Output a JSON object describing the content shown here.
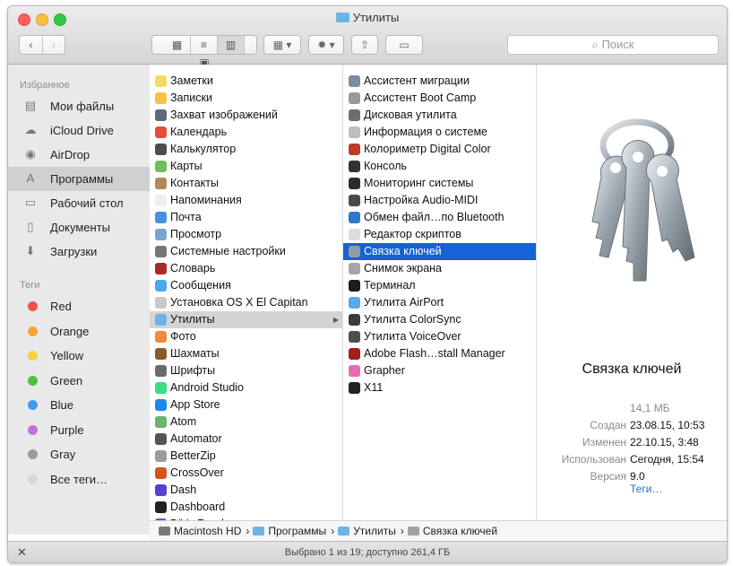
{
  "window": {
    "title": "Утилиты"
  },
  "toolbar": {
    "back": "‹",
    "forward": "›",
    "search_placeholder": "Поиск"
  },
  "sidebar": {
    "favorites_header": "Избранное",
    "favorites": [
      {
        "label": "Мои файлы",
        "icon": "all-files-icon",
        "glyph": "▤"
      },
      {
        "label": "iCloud Drive",
        "icon": "cloud-icon",
        "glyph": "☁"
      },
      {
        "label": "AirDrop",
        "icon": "airdrop-icon",
        "glyph": "◉"
      },
      {
        "label": "Программы",
        "icon": "applications-icon",
        "glyph": "A"
      },
      {
        "label": "Рабочий стол",
        "icon": "desktop-icon",
        "glyph": "▭"
      },
      {
        "label": "Документы",
        "icon": "documents-icon",
        "glyph": "▯"
      },
      {
        "label": "Загрузки",
        "icon": "downloads-icon",
        "glyph": "⬇"
      }
    ],
    "tags_header": "Теги",
    "tags": [
      {
        "label": "Red",
        "color": "#f34f4f"
      },
      {
        "label": "Orange",
        "color": "#f9a234"
      },
      {
        "label": "Yellow",
        "color": "#f7d040"
      },
      {
        "label": "Green",
        "color": "#4cc144"
      },
      {
        "label": "Blue",
        "color": "#3d9bf3"
      },
      {
        "label": "Purple",
        "color": "#bd75de"
      },
      {
        "label": "Gray",
        "color": "#9a9a9a"
      },
      {
        "label": "Все теги…",
        "color": "#d8d8d8"
      }
    ]
  },
  "column1": [
    {
      "label": "Заметки",
      "color": "#f5d867"
    },
    {
      "label": "Записки",
      "color": "#f6c343"
    },
    {
      "label": "Захват изображений",
      "color": "#5b6a7c"
    },
    {
      "label": "Календарь",
      "color": "#e94b3c"
    },
    {
      "label": "Калькулятор",
      "color": "#4d4d4d"
    },
    {
      "label": "Карты",
      "color": "#6fbf5f"
    },
    {
      "label": "Контакты",
      "color": "#b5865a"
    },
    {
      "label": "Напоминания",
      "color": "#eeeeee"
    },
    {
      "label": "Почта",
      "color": "#4a90e2"
    },
    {
      "label": "Просмотр",
      "color": "#7aa3cf"
    },
    {
      "label": "Системные настройки",
      "color": "#777777"
    },
    {
      "label": "Словарь",
      "color": "#a52a2a"
    },
    {
      "label": "Сообщения",
      "color": "#4aa8f0"
    },
    {
      "label": "Установка OS X El Capitan",
      "color": "#c9c9c9"
    },
    {
      "label": "Утилиты",
      "color": "#6db3e8"
    },
    {
      "label": "Фото",
      "color": "#f08a3c"
    },
    {
      "label": "Шахматы",
      "color": "#8b5a2b"
    },
    {
      "label": "Шрифты",
      "color": "#6a6a6a"
    },
    {
      "label": "Android Studio",
      "color": "#3ddc84"
    },
    {
      "label": "App Store",
      "color": "#1e88e5"
    },
    {
      "label": "Atom",
      "color": "#66b66e"
    },
    {
      "label": "Automator",
      "color": "#555555"
    },
    {
      "label": "BetterZip",
      "color": "#9b9b9b"
    },
    {
      "label": "CrossOver",
      "color": "#d6551f"
    },
    {
      "label": "Dash",
      "color": "#5a3fd1"
    },
    {
      "label": "Dashboard",
      "color": "#222222"
    },
    {
      "label": "DjVu Reader",
      "color": "#7a4fc9"
    }
  ],
  "column2": [
    {
      "label": "Ассистент миграции",
      "color": "#7b8d9e"
    },
    {
      "label": "Ассистент Boot Camp",
      "color": "#9a9a9a"
    },
    {
      "label": "Дисковая утилита",
      "color": "#6e6e6e"
    },
    {
      "label": "Информация о системе",
      "color": "#bdbdbd"
    },
    {
      "label": "Колориметр Digital Color",
      "color": "#c0392b"
    },
    {
      "label": "Консоль",
      "color": "#333333"
    },
    {
      "label": "Мониторинг системы",
      "color": "#2c2c2c"
    },
    {
      "label": "Настройка Audio-MIDI",
      "color": "#4a4a4a"
    },
    {
      "label": "Обмен файл…по Bluetooth",
      "color": "#2f78c8"
    },
    {
      "label": "Редактор скриптов",
      "color": "#dcdcdc"
    },
    {
      "label": "Связка ключей",
      "color": "#8e9aa5"
    },
    {
      "label": "Снимок экрана",
      "color": "#a5a5a5"
    },
    {
      "label": "Терминал",
      "color": "#1d1d1d"
    },
    {
      "label": "Утилита AirPort",
      "color": "#5aa8e8"
    },
    {
      "label": "Утилита ColorSync",
      "color": "#3a3a3a"
    },
    {
      "label": "Утилита VoiceOver",
      "color": "#4e4e4e"
    },
    {
      "label": "Adobe Flash…stall Manager",
      "color": "#a51d1d"
    },
    {
      "label": "Grapher",
      "color": "#e86bb0"
    },
    {
      "label": "X11",
      "color": "#222222"
    }
  ],
  "preview": {
    "name": "Связка ключей",
    "size": "14,1 МБ",
    "rows": [
      {
        "k": "Создан",
        "v": "23.08.15, 10:53"
      },
      {
        "k": "Изменен",
        "v": "22.10.15, 3:48"
      },
      {
        "k": "Использован",
        "v": "Сегодня, 15:54"
      },
      {
        "k": "Версия",
        "v": "9.0"
      }
    ],
    "tags_link": "Теги…"
  },
  "path": {
    "items": [
      "Macintosh HD",
      "Программы",
      "Утилиты",
      "Связка ключей"
    ],
    "separator": "›"
  },
  "status": {
    "text": "Выбрано 1 из 19; доступно 261,4 ГБ",
    "left_icon": "✕"
  }
}
